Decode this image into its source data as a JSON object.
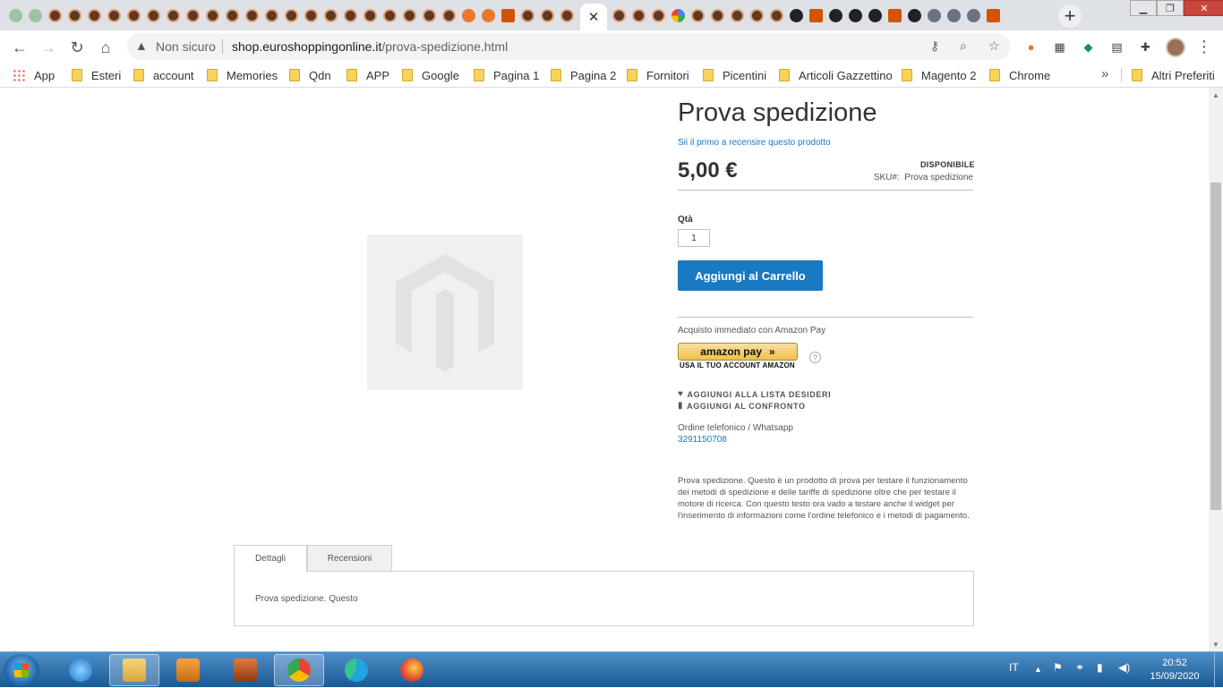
{
  "browser": {
    "active_tab_close": "✕",
    "new_tab": "+",
    "window_controls": {
      "minimize": "▁",
      "restore": "❐",
      "close": "✕"
    },
    "security_label": "Non sicuro",
    "url_host": "shop.euroshoppingonline.it",
    "url_path": "/prova-spedizione.html"
  },
  "bookmarks": [
    {
      "label": "App",
      "icon": "apps-icon"
    },
    {
      "label": "Esteri"
    },
    {
      "label": "account"
    },
    {
      "label": "Memories"
    },
    {
      "label": "Qdn"
    },
    {
      "label": "APP"
    },
    {
      "label": "Google"
    },
    {
      "label": "Pagina 1"
    },
    {
      "label": "Pagina 2"
    },
    {
      "label": "Fornitori"
    },
    {
      "label": "Picentini"
    },
    {
      "label": "Articoli Gazzettino"
    },
    {
      "label": "Magento 2"
    },
    {
      "label": "Chrome"
    }
  ],
  "bookmarks_more": "»",
  "other_bookmarks": "Altri Preferiti",
  "product": {
    "title": "Prova spedizione",
    "review_link": "Sii il primo a recensire questo prodotto",
    "price": "5,00 €",
    "stock": "DISPONIBILE",
    "sku_label": "SKU#:",
    "sku_value": "Prova spedizione",
    "qty_label": "Qtà",
    "qty_value": "1",
    "add_to_cart": "Aggiungi al Carrello",
    "amazon_label": "Acquisto immediato con Amazon Pay",
    "amazon_button": "amazon pay",
    "amazon_sub": "USA IL TUO ACCOUNT AMAZON",
    "wishlist": "AGGIUNGI ALLA LISTA DESIDERI",
    "compare": "AGGIUNGI AL CONFRONTO",
    "phone_label": "Ordine telefonico / Whatsapp",
    "phone_number": "3291150708",
    "description": "Prova spedizione. Questo è un prodotto di prova per testare il funzionamento dei metodi di spedizione e delle tariffe di spedizione oltre che per testare il motore di ricerca. Con questo testo ora vado a testare anche il widget per l'inserimento di informazioni come l'ordine telefonico e i metodi di pagamento."
  },
  "tabs": [
    {
      "label": "Dettagli",
      "active": true
    },
    {
      "label": "Recensioni",
      "active": false
    }
  ],
  "tab_content": "Prova spedizione. Questo",
  "taskbar": {
    "language": "IT",
    "time": "20:52",
    "date": "15/09/2020"
  },
  "colors": {
    "accent": "#1979c3",
    "taskbar": "#1a5a94"
  }
}
